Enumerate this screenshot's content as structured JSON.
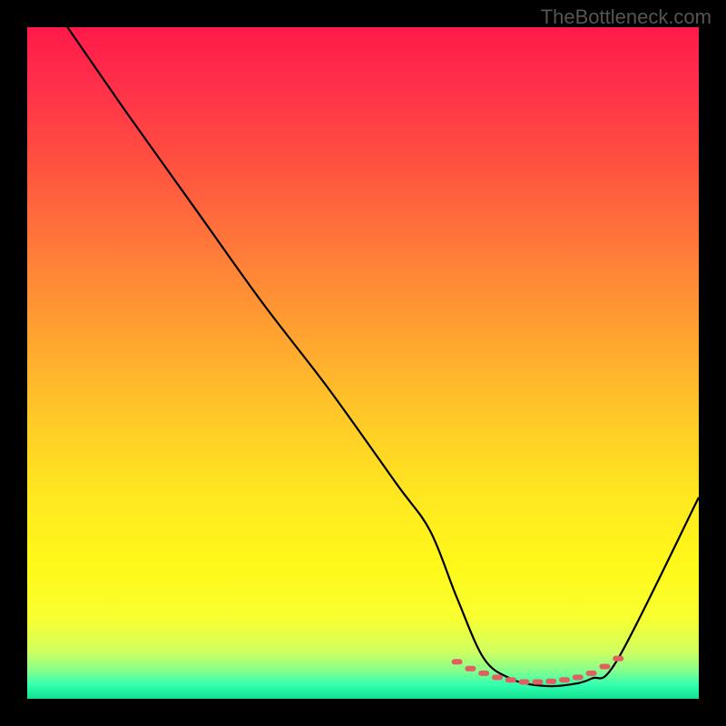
{
  "watermark": "TheBottleneck.com",
  "chart_data": {
    "type": "line",
    "title": "",
    "xlabel": "",
    "ylabel": "",
    "xlim": [
      0,
      100
    ],
    "ylim": [
      0,
      100
    ],
    "series": [
      {
        "name": "bottleneck-curve",
        "x": [
          6,
          15,
          25,
          35,
          45,
          55,
          60,
          64,
          68,
          72,
          76,
          80,
          84,
          88,
          100
        ],
        "y": [
          100,
          87,
          73,
          59,
          46,
          32,
          25,
          15,
          6,
          3,
          2,
          2,
          3,
          6,
          30
        ],
        "stroke": "#000000"
      }
    ],
    "markers": {
      "name": "optimal-range-dots",
      "x": [
        64,
        66,
        68,
        70,
        72,
        74,
        76,
        78,
        80,
        82,
        84,
        86,
        88
      ],
      "y": [
        5.5,
        4.5,
        3.8,
        3.2,
        2.8,
        2.5,
        2.5,
        2.6,
        2.8,
        3.2,
        3.8,
        4.8,
        6
      ],
      "color": "#e06060"
    },
    "background_gradient": {
      "orientation": "vertical",
      "stops": [
        {
          "pos": 0.0,
          "color": "#ff1a4a"
        },
        {
          "pos": 0.2,
          "color": "#ff5040"
        },
        {
          "pos": 0.45,
          "color": "#ffa030"
        },
        {
          "pos": 0.7,
          "color": "#ffe820"
        },
        {
          "pos": 0.88,
          "color": "#f8ff30"
        },
        {
          "pos": 0.96,
          "color": "#80ff90"
        },
        {
          "pos": 1.0,
          "color": "#10e090"
        }
      ]
    }
  }
}
